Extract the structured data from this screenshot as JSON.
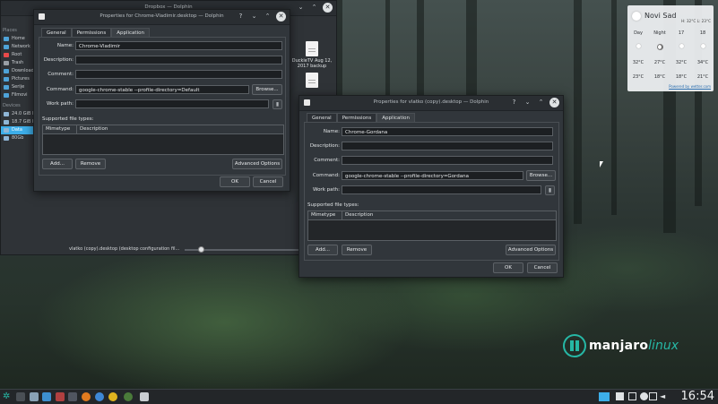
{
  "dolphin": {
    "title": "Dropbox — Dolphin",
    "places_header": "Places",
    "places": [
      "Home",
      "Network",
      "Root",
      "Trash",
      "Download",
      "Pictures",
      "Serije",
      "Filmovi"
    ],
    "devices_header": "Devices",
    "devices": [
      "24.0 GiB H",
      "18.7 GiB H",
      "Data",
      "80Gb"
    ],
    "files": [
      {
        "name": "DuckieTV Aug 12, 2017 backup"
      }
    ],
    "status_text": "vlatko (copy).desktop (desktop configuration fil..."
  },
  "dialog1": {
    "title": "Properties for Chrome-Vladimir.desktop — Dolphin",
    "tabs": [
      "General",
      "Permissions",
      "Application"
    ],
    "labels": {
      "name": "Name:",
      "description": "Description:",
      "comment": "Comment:",
      "command": "Command:",
      "work_path": "Work path:"
    },
    "values": {
      "name": "Chrome-Vladimir",
      "description": "",
      "comment": "",
      "command": "google-chrome-stable --profile-directory=Default",
      "work_path": ""
    },
    "browse": "Browse...",
    "supported": "Supported file types:",
    "col_mimetype": "Mimetype",
    "col_description": "Description",
    "add": "Add...",
    "remove": "Remove",
    "advanced": "Advanced Options",
    "ok": "OK",
    "cancel": "Cancel"
  },
  "dialog2": {
    "title": "Properties for vlatko (copy).desktop — Dolphin",
    "tabs": [
      "General",
      "Permissions",
      "Application"
    ],
    "labels": {
      "name": "Name:",
      "description": "Description:",
      "comment": "Comment:",
      "command": "Command:",
      "work_path": "Work path:"
    },
    "values": {
      "name": "Chrome-Gordana",
      "description": "",
      "comment": "",
      "command": "google-chrome-stable --profile-directory=Gordana",
      "work_path": ""
    },
    "browse": "Browse...",
    "supported": "Supported file types:",
    "col_mimetype": "Mimetype",
    "col_description": "Description",
    "add": "Add...",
    "remove": "Remove",
    "advanced": "Advanced Options",
    "ok": "OK",
    "cancel": "Cancel"
  },
  "weather": {
    "city": "Novi Sad",
    "high_low": "H: 32°C L: 23°C",
    "columns": [
      "Day",
      "Night",
      "17",
      "18"
    ],
    "highs": [
      "32°C",
      "27°C",
      "32°C",
      "34°C"
    ],
    "lows": [
      "23°C",
      "18°C",
      "18°C",
      "21°C"
    ],
    "powered": "Powered by wetter.com"
  },
  "logo": {
    "word1": "manjaro",
    "word2": "linux"
  },
  "taskbar": {
    "clock": "16:54"
  },
  "colors": {
    "accent": "#3daee9",
    "manjaro": "#26b7a5",
    "window_bg": "#31363b"
  }
}
